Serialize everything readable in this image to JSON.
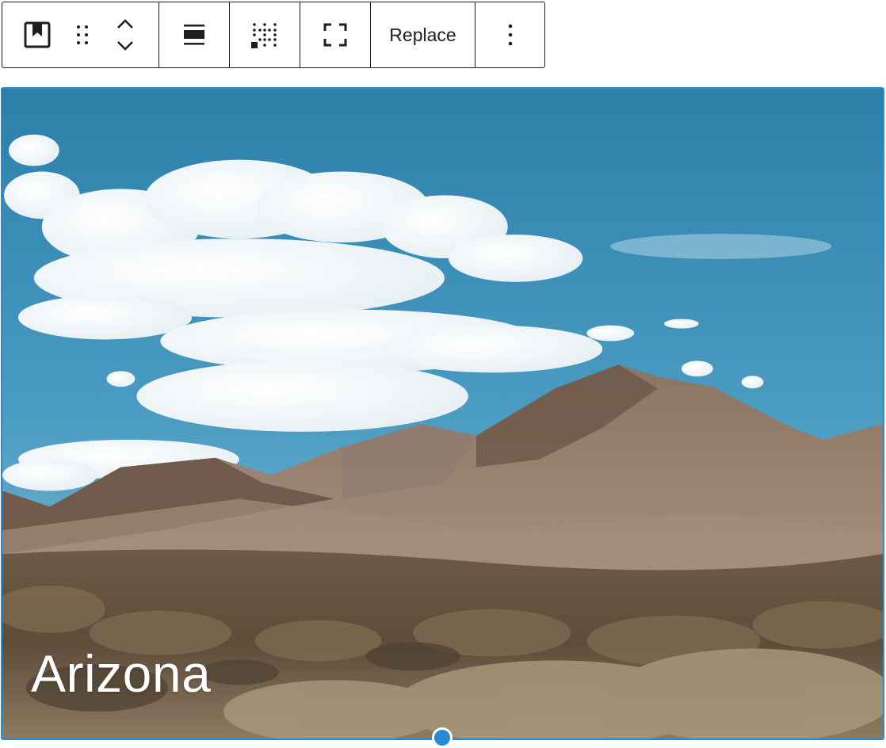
{
  "toolbar": {
    "block_icon": "cover-block-icon",
    "drag_icon": "drag-handle-icon",
    "move_up_icon": "chevron-up-icon",
    "move_down_icon": "chevron-down-icon",
    "align_icon": "align-wide-icon",
    "position_icon": "content-position-icon",
    "fullheight_icon": "fullscreen-icon",
    "replace_label": "Replace",
    "options_icon": "more-vertical-icon"
  },
  "cover": {
    "title": "Arizona",
    "accent_color": "#2b8ad6"
  }
}
